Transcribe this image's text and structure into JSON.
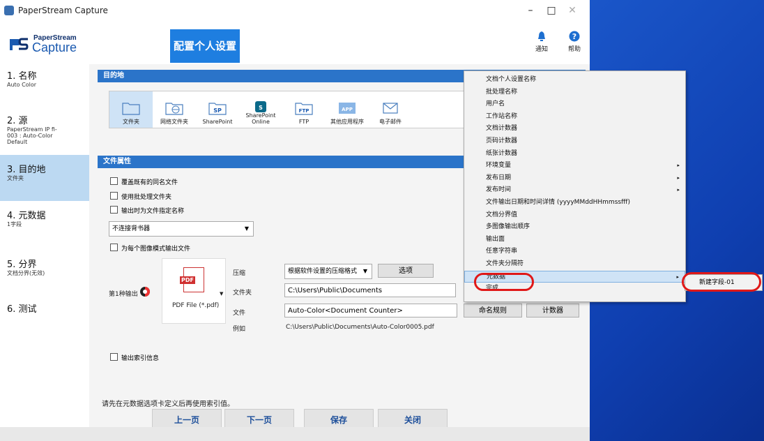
{
  "window": {
    "title": "PaperStream Capture",
    "minimize": "–",
    "maximize": "□",
    "close": "✕"
  },
  "header": {
    "logo_top": "PaperStream",
    "logo_bottom": "Capture",
    "banner": "配置个人设置",
    "notify_label": "通知",
    "help_label": "帮助"
  },
  "sidebar": {
    "items": [
      {
        "num": "1. 名称",
        "sub": "Auto Color"
      },
      {
        "num": "2. 源",
        "sub": "PaperStream IP fi-\n003 : Auto-Color\nDefault"
      },
      {
        "num": "3. 目的地",
        "sub": "文件夹"
      },
      {
        "num": "4. 元数据",
        "sub": "1字段"
      },
      {
        "num": "5. 分界",
        "sub": "文档分界(无效)"
      },
      {
        "num": "6. 测试",
        "sub": ""
      }
    ]
  },
  "dest": {
    "header": "目的地",
    "items": [
      {
        "label": "文件夹",
        "icon": "folder-icon"
      },
      {
        "label": "网络文件夹",
        "icon": "network-folder-icon"
      },
      {
        "label": "SharePoint",
        "icon": "sharepoint-icon"
      },
      {
        "label": "SharePoint Online",
        "icon": "sharepoint-online-icon"
      },
      {
        "label": "FTP",
        "icon": "ftp-icon"
      },
      {
        "label": "其他应用程序",
        "icon": "app-icon"
      },
      {
        "label": "电子邮件",
        "icon": "mail-icon"
      }
    ]
  },
  "file": {
    "header": "文件属性",
    "overwrite": "覆盖既有的同名文件",
    "use_batch": "使用批处理文件夹",
    "specify_name": "输出时为文件指定名称",
    "bookmark": "不连接背书器",
    "per_mode": "为每个图像模式输出文件",
    "output1": "第1种输出",
    "format": "PDF File (*.pdf)",
    "pdf_tag": "PDF",
    "compress_label": "压缩",
    "compress_value": "根据软件设置的压缩格式",
    "options_btn": "选项",
    "folder_label": "文件夹",
    "folder_value": "C:\\Users\\Public\\Documents",
    "file_label": "文件",
    "file_value": "Auto-Color<Document Counter>",
    "naming_btn": "命名规则",
    "counter_btn": "计数器",
    "example_label": "例如",
    "example_value": "C:\\Users\\Public\\Documents\\Auto-Color0005.pdf",
    "index_info": "输出索引信息",
    "notice": "请先在元数据选项卡定义后再使用索引值。"
  },
  "nav": {
    "prev": "上一页",
    "next": "下一页",
    "save": "保存",
    "close": "关闭"
  },
  "context_menu": [
    {
      "label": "文档个人设置名称",
      "has_sub": false
    },
    {
      "label": "批处理名称",
      "has_sub": false
    },
    {
      "label": "用户名",
      "has_sub": false
    },
    {
      "label": "工作站名称",
      "has_sub": false
    },
    {
      "label": "文档计数器",
      "has_sub": false
    },
    {
      "label": "页码计数器",
      "has_sub": false
    },
    {
      "label": "纸张计数器",
      "has_sub": false
    },
    {
      "label": "环境变量",
      "has_sub": true
    },
    {
      "label": "发布日期",
      "has_sub": true
    },
    {
      "label": "发布时间",
      "has_sub": true
    },
    {
      "label": "文件输出日期和时间详情 (yyyyMMddHHmmssfff)",
      "has_sub": false
    },
    {
      "label": "文档分界值",
      "has_sub": false
    },
    {
      "label": "多图像输出顺序",
      "has_sub": false
    },
    {
      "label": "输出面",
      "has_sub": false
    },
    {
      "label": "任意字符串",
      "has_sub": false
    },
    {
      "label": "文件夹分隔符",
      "has_sub": false
    },
    {
      "label": "元数据",
      "has_sub": true
    },
    {
      "label": "完成",
      "has_sub": false
    }
  ],
  "submenu": {
    "label": "新建字段-01"
  },
  "arrow_glyph": "▸",
  "colors": {
    "accent": "#1e7ee0",
    "section": "#2b74c9",
    "highlight_ring": "#e01818",
    "selected": "#cfe3f6"
  }
}
